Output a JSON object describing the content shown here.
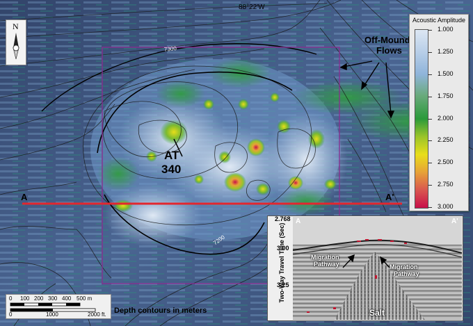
{
  "map": {
    "longitude_label": "88°22'W",
    "title_block": "AT 340",
    "title_line1": "AT",
    "title_line2": "340",
    "off_mound_line1": "Off-Mound",
    "off_mound_line2": "Flows",
    "contour_7300": "7300",
    "contour_7200": "7200",
    "section_start": "A",
    "section_end": "A'",
    "depth_note": "Depth contours in meters"
  },
  "legend": {
    "title": "Acoustic Amplitude",
    "ticks": [
      "1.000",
      "1.250",
      "1.500",
      "1.750",
      "2.000",
      "2.250",
      "2.500",
      "2.750",
      "3.000"
    ]
  },
  "inset": {
    "corner_left": "A",
    "corner_right": "A'",
    "y_axis_label": "Two-Way Travel Time (Sec)",
    "y_ticks": [
      "2.768",
      "3.00",
      "3.25"
    ],
    "left_label_line1": "Migration",
    "left_label_line2": "Pathway",
    "right_label_line1": "Migration",
    "right_label_line2": "Pathway",
    "salt_label": "Salt"
  },
  "scale": {
    "meter_ticks": [
      "0",
      "100",
      "200",
      "300",
      "400",
      "500 m"
    ],
    "feet_ticks": [
      "0",
      "1000",
      "2000 ft."
    ]
  },
  "north": {
    "letter": "N"
  },
  "colors": {
    "section_line": "#e3262e",
    "study_box": "#8a2c8f",
    "contour": "#1a1a1a",
    "amplitude_low": "#dde7f3",
    "amplitude_mid": "#2a9a3a",
    "amplitude_high": "#c8104a"
  }
}
